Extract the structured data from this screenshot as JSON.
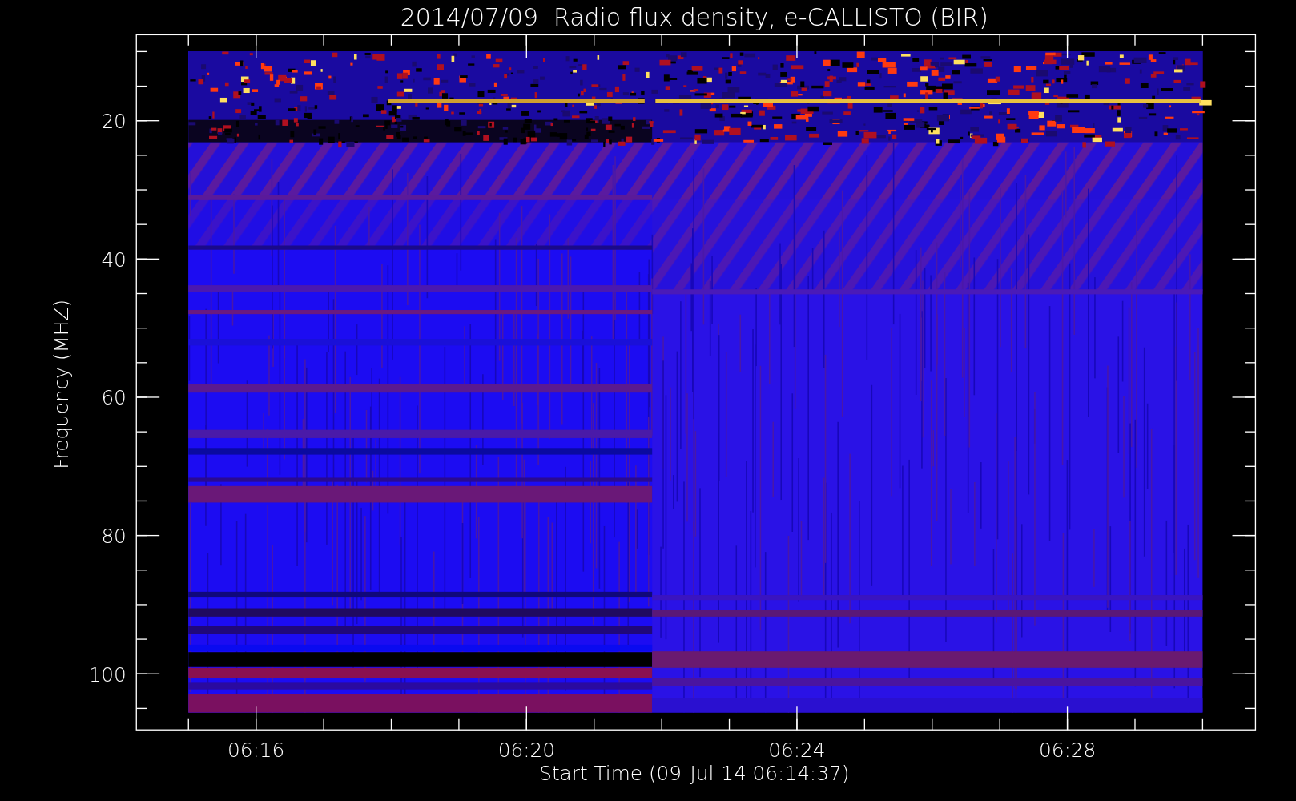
{
  "title": "2014/07/09  Radio flux density, e-CALLISTO (BIR)",
  "y_axis": {
    "label": "Frequency (MHZ)",
    "ticks": [
      "20",
      "40",
      "60",
      "80",
      "100"
    ]
  },
  "x_axis": {
    "label": "Start Time (09-Jul-14 06:14:37)",
    "ticks": [
      "06:16",
      "06:20",
      "06:24",
      "06:28"
    ]
  }
}
